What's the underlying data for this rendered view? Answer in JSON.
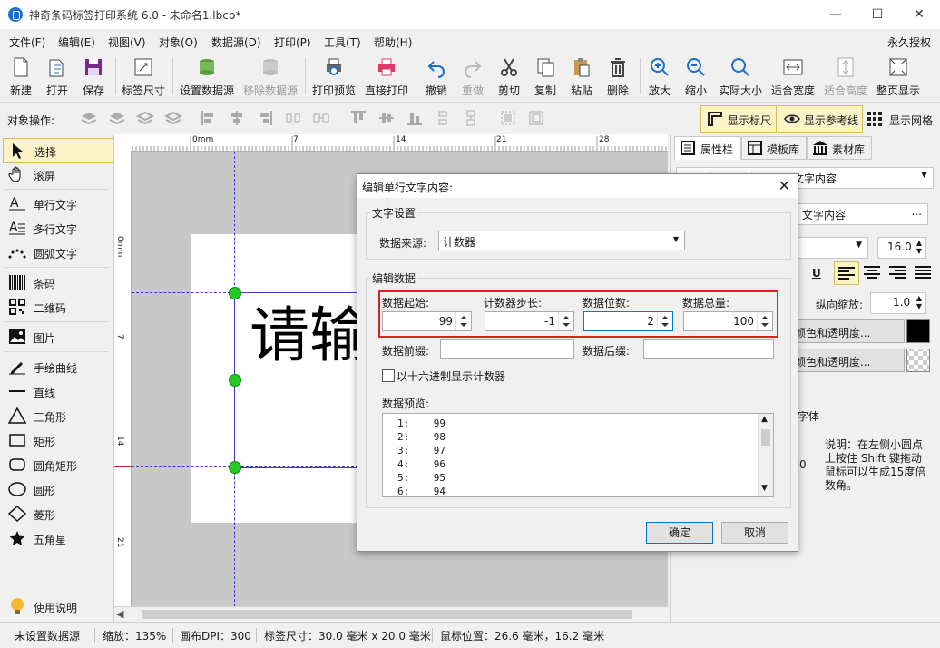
{
  "window": {
    "title": "神奇条码标签打印系统 6.0 - 未命名1.lbcp*",
    "minimize": "—",
    "maximize": "☐",
    "close": "✕"
  },
  "menu": {
    "items": [
      "文件(F)",
      "编辑(E)",
      "视图(V)",
      "对象(O)",
      "数据源(D)",
      "打印(P)",
      "工具(T)",
      "帮助(H)"
    ],
    "auth": "永久授权"
  },
  "toolbar": {
    "items": [
      "新建",
      "打开",
      "保存",
      "标签尺寸",
      "设置数据源",
      "移除数据源",
      "打印预览",
      "直接打印",
      "撤销",
      "重做",
      "剪切",
      "复制",
      "粘贴",
      "删除",
      "放大",
      "缩小",
      "实际大小",
      "适合宽度",
      "适合高度",
      "整页显示"
    ]
  },
  "ops": {
    "label": "对象操作:",
    "show_ruler": "显示标尺",
    "show_guides": "显示参考线",
    "show_grid": "显示网格"
  },
  "tools": {
    "items": [
      "选择",
      "滚屏",
      "单行文字",
      "多行文字",
      "圆弧文字",
      "条码",
      "二维码",
      "图片",
      "手绘曲线",
      "直线",
      "三角形",
      "矩形",
      "圆角矩形",
      "圆形",
      "菱形",
      "五角星",
      "使用说明"
    ]
  },
  "canvas": {
    "ruler_h": [
      "0mm",
      "7",
      "14",
      "21",
      "28"
    ],
    "ruler_v": [
      "0mm",
      "7",
      "14",
      "21"
    ],
    "sample_text": "请输"
  },
  "right_panel": {
    "tabs": [
      "属性栏",
      "模板库",
      "素材库"
    ],
    "object_select": "单行文字 - 请输入单行文字内容",
    "content_value": "文字内容",
    "font_size": "16.0",
    "vscale_label": "纵向缩放:",
    "vscale_value": "1.0",
    "fill_color_label": "颜色和透明度...",
    "bg_color_label": "颜色和透明度...",
    "font_label": "字体",
    "zero": "0",
    "note": "说明：在左侧小圆点上按住 Shift 键拖动鼠标可以生成15度倍数角。"
  },
  "dialog": {
    "title": "编辑单行文字内容:",
    "text_settings": "文字设置",
    "source_label": "数据来源:",
    "source_value": "计数器",
    "edit_data": "编辑数据",
    "start_label": "数据起始:",
    "start_value": "99",
    "step_label": "计数器步长:",
    "step_value": "-1",
    "digits_label": "数据位数:",
    "digits_value": "2",
    "total_label": "数据总量:",
    "total_value": "100",
    "prefix_label": "数据前缀:",
    "suffix_label": "数据后缀:",
    "hex_label": "以十六进制显示计数器",
    "preview_label": "数据预览:",
    "preview_rows": [
      "1:    99",
      "2:    98",
      "3:    97",
      "4:    96",
      "5:    95",
      "6:    94"
    ],
    "ok": "确定",
    "cancel": "取消"
  },
  "status": {
    "datasource": "未设置数据源",
    "zoom": "缩放：135%",
    "dpi": "画布DPI：300",
    "label_size": "标签尺寸：30.0 毫米 x 20.0 毫米",
    "mouse_pos": "鼠标位置：26.6 毫米，16.2 毫米"
  }
}
